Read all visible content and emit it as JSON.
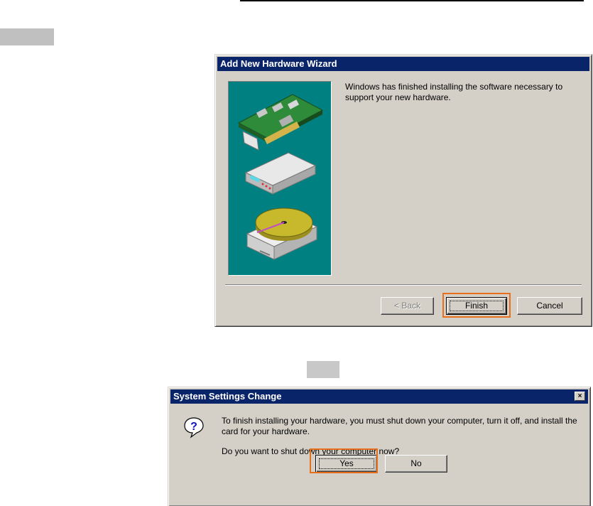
{
  "wizard": {
    "title": "Add New Hardware Wizard",
    "message": "Windows has finished installing the software necessary to support your new hardware.",
    "back_label": "< Back",
    "finish_label": "Finish",
    "cancel_label": "Cancel"
  },
  "system_dialog": {
    "title": "System Settings Change",
    "close_label": "×",
    "message_1": "To finish installing your hardware, you must shut down your computer, turn it off, and install the card for your hardware.",
    "message_2": "Do you want to shut down your computer now?",
    "yes_label": "Yes",
    "no_label": "No",
    "icon": "question-icon"
  },
  "colors": {
    "titlebar": "#0a246a",
    "dialog_bg": "#d4d0c8",
    "wizard_image_bg": "#008080",
    "highlight": "#e86f1c"
  }
}
